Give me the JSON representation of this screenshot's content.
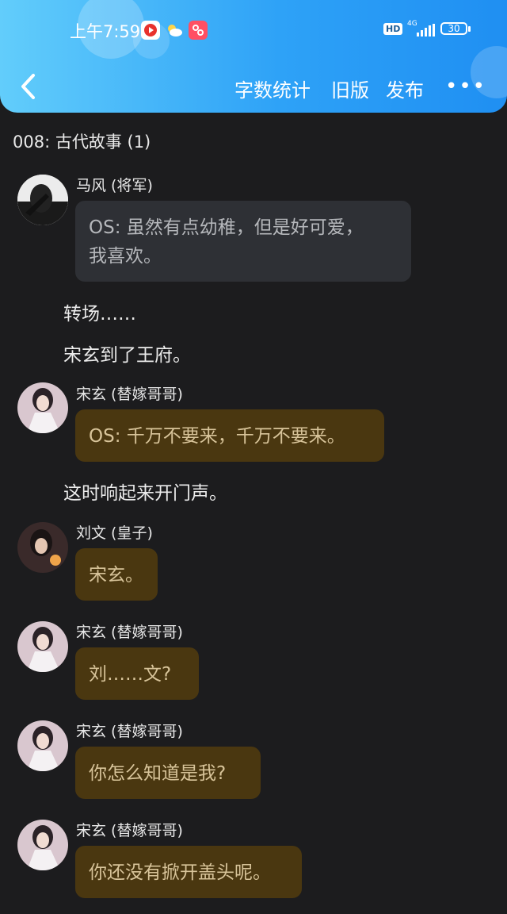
{
  "status_bar": {
    "time": "上午7:59",
    "network": "4G",
    "hd_label": "HD",
    "battery": "30"
  },
  "toolbar": {
    "word_count": "字数统计",
    "old_version": "旧版",
    "publish": "发布",
    "more": "•••"
  },
  "chapter_title": "008: 古代故事 (1)",
  "messages": [
    {
      "speaker": "马风 (将军)",
      "text1": "OS: 虽然有点幼稚，但是好可爱，",
      "text2": "我喜欢。"
    },
    {
      "narration": "转场……"
    },
    {
      "narration": "宋玄到了王府。"
    },
    {
      "speaker": "宋玄 (替嫁哥哥)",
      "text": "OS: 千万不要来，千万不要来。"
    },
    {
      "narration": "这时响起来开门声。"
    },
    {
      "speaker": "刘文 (皇子)",
      "text": "宋玄。"
    },
    {
      "speaker": "宋玄 (替嫁哥哥)",
      "text": "刘……文?"
    },
    {
      "speaker": "宋玄 (替嫁哥哥)",
      "text": "你怎么知道是我?"
    },
    {
      "speaker": "宋玄 (替嫁哥哥)",
      "text": "你还没有掀开盖头呢。"
    }
  ],
  "colors": {
    "header_start": "#62cdfb",
    "header_end": "#1f8ff2",
    "background": "#1c1c1e",
    "bubble_grey": "#2e3035",
    "bubble_gold": "#4a3710"
  }
}
